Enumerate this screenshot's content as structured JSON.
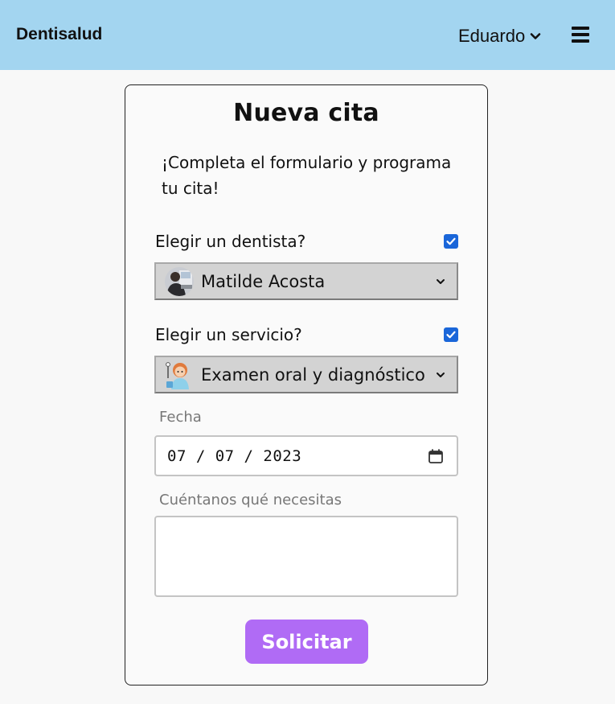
{
  "header": {
    "brand": "Dentisalud",
    "user_name": "Eduardo"
  },
  "form": {
    "title": "Nueva cita",
    "subtitle": "¡Completa el formulario y programa tu cita!",
    "dentist_toggle_label": "Elegir un dentista?",
    "dentist_toggle_checked": true,
    "dentist_selected": "Matilde Acosta",
    "service_toggle_label": "Elegir un servicio?",
    "service_toggle_checked": true,
    "service_selected": "Examen oral y diagnóstico",
    "date_label": "Fecha",
    "date_value": "07 / 07 / 2023",
    "needs_label": "Cuéntanos qué necesitas",
    "needs_value": "",
    "submit_label": "Solicitar"
  },
  "colors": {
    "navbar": "#a3d5f0",
    "checkbox": "#1a66d9",
    "submit": "#b06bf5"
  },
  "icons": {
    "user_menu": "chevron-down-icon",
    "menu": "hamburger-menu-icon",
    "dentist_option": "dentist-avatar-icon",
    "service_option": "dentist-service-icon",
    "date": "calendar-icon"
  }
}
